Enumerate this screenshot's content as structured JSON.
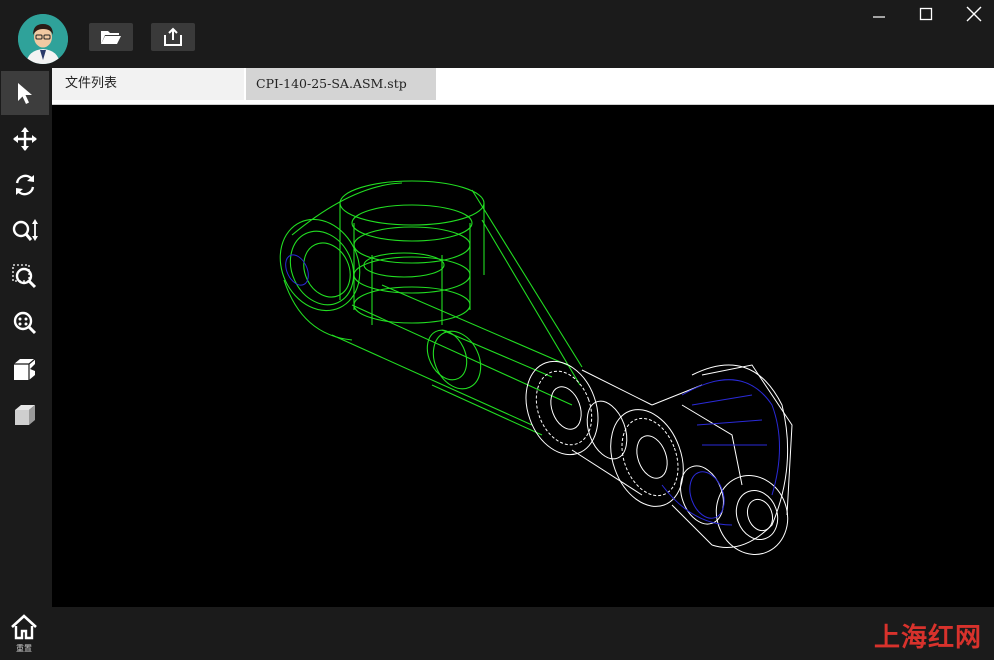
{
  "titlebar": {
    "open_button_icon": "folder-open-icon",
    "export_button_icon": "share-export-icon",
    "window_controls": [
      "minimize-icon",
      "maximize-icon",
      "close-icon"
    ]
  },
  "sidebar": {
    "tools": [
      {
        "name": "select",
        "icon": "cursor-arrow-icon",
        "active": true
      },
      {
        "name": "pan",
        "icon": "move-arrows-icon",
        "active": false
      },
      {
        "name": "rotate",
        "icon": "rotate-icon",
        "active": false
      },
      {
        "name": "zoom",
        "icon": "zoom-updown-icon",
        "active": false
      },
      {
        "name": "zoom-window",
        "icon": "zoom-window-icon",
        "active": false
      },
      {
        "name": "zoom-fit",
        "icon": "zoom-fit-icon",
        "active": false
      },
      {
        "name": "section",
        "icon": "section-view-icon",
        "active": false
      },
      {
        "name": "view-cube",
        "icon": "cube-icon",
        "active": false
      }
    ]
  },
  "tabs": {
    "file_list": "文件列表",
    "open_file": "CPI-140-25-SA.ASM.stp"
  },
  "bottombar": {
    "home_label": "重置",
    "watermark": "上海红网"
  },
  "colors": {
    "background": "#1b1b1b",
    "viewport": "#000000",
    "wire_green": "#22dd22",
    "wire_white": "#ffffff",
    "wire_blue": "#2a2ad8"
  }
}
